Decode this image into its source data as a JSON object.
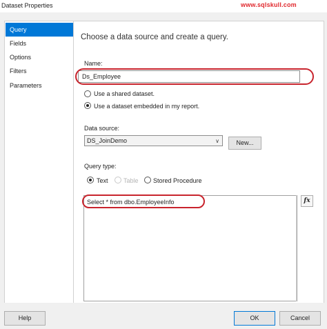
{
  "window": {
    "title": "Dataset Properties",
    "watermark": "www.sqlskull.com"
  },
  "sidebar": {
    "items": [
      {
        "label": "Query",
        "selected": true
      },
      {
        "label": "Fields",
        "selected": false
      },
      {
        "label": "Options",
        "selected": false
      },
      {
        "label": "Filters",
        "selected": false
      },
      {
        "label": "Parameters",
        "selected": false
      }
    ]
  },
  "main": {
    "heading": "Choose a data source and create a query.",
    "name_label": "Name:",
    "name_value": "Ds_Employee",
    "dataset_options": [
      {
        "label": "Use a shared dataset.",
        "checked": false
      },
      {
        "label": "Use a dataset embedded in my report.",
        "checked": true
      }
    ],
    "datasource_label": "Data source:",
    "datasource_value": "DS_JoinDemo",
    "new_button": "New...",
    "querytype_label": "Query type:",
    "querytype_options": [
      {
        "label": "Text",
        "checked": true,
        "enabled": true
      },
      {
        "label": "Table",
        "checked": false,
        "enabled": false
      },
      {
        "label": "Stored Procedure",
        "checked": false,
        "enabled": true
      }
    ],
    "query_text": "Select * from dbo.EmployeeInfo",
    "fx_button": "fx"
  },
  "footer": {
    "help": "Help",
    "ok": "OK",
    "cancel": "Cancel"
  },
  "colors": {
    "selection": "#0078d7",
    "highlight_oval": "#c8232c",
    "watermark": "#e0282d"
  }
}
